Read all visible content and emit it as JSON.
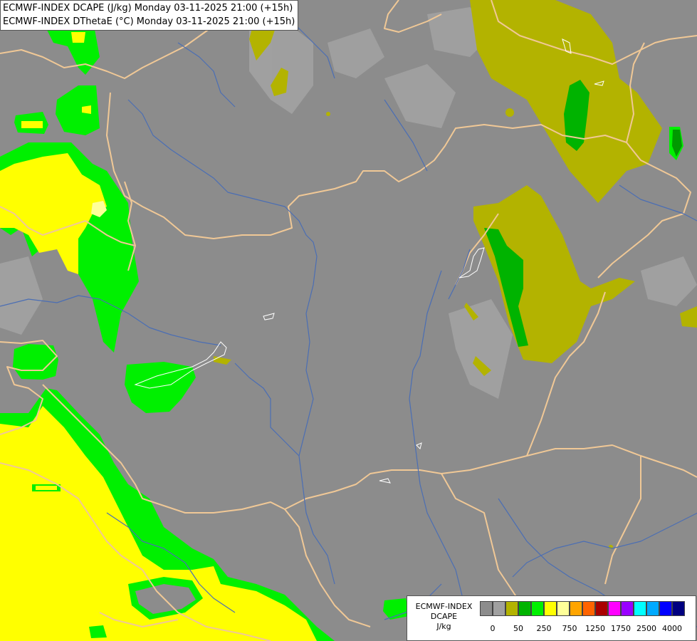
{
  "title_lines": [
    "ECMWF-INDEX DCAPE (J/kg) Monday 03-11-2025 21:00 (+15h)",
    "ECMWF-INDEX DThetaE (°C) Monday 03-11-2025 21:00 (+15h)"
  ],
  "legend": {
    "title_lines": [
      "ECMWF-INDEX",
      "DCAPE",
      "J/kg"
    ],
    "colors": [
      "#8c8c8c",
      "#a0a0a0",
      "#b3b300",
      "#00b300",
      "#00f000",
      "#ffff00",
      "#ffff99",
      "#ffa500",
      "#ff6400",
      "#aa0000",
      "#ff00ff",
      "#9900ff",
      "#00ffff",
      "#00aaff",
      "#0000ff",
      "#000080"
    ],
    "tick_labels": [
      "0",
      "50",
      "250",
      "750",
      "1250",
      "1750",
      "2500",
      "4000"
    ]
  },
  "colors": {
    "background": "#8c8c8c",
    "dthetae_shade": "#a3a3a3",
    "borders": "#f0c896",
    "rivers": "#4b6eb4",
    "lakes": "#ffffff"
  }
}
